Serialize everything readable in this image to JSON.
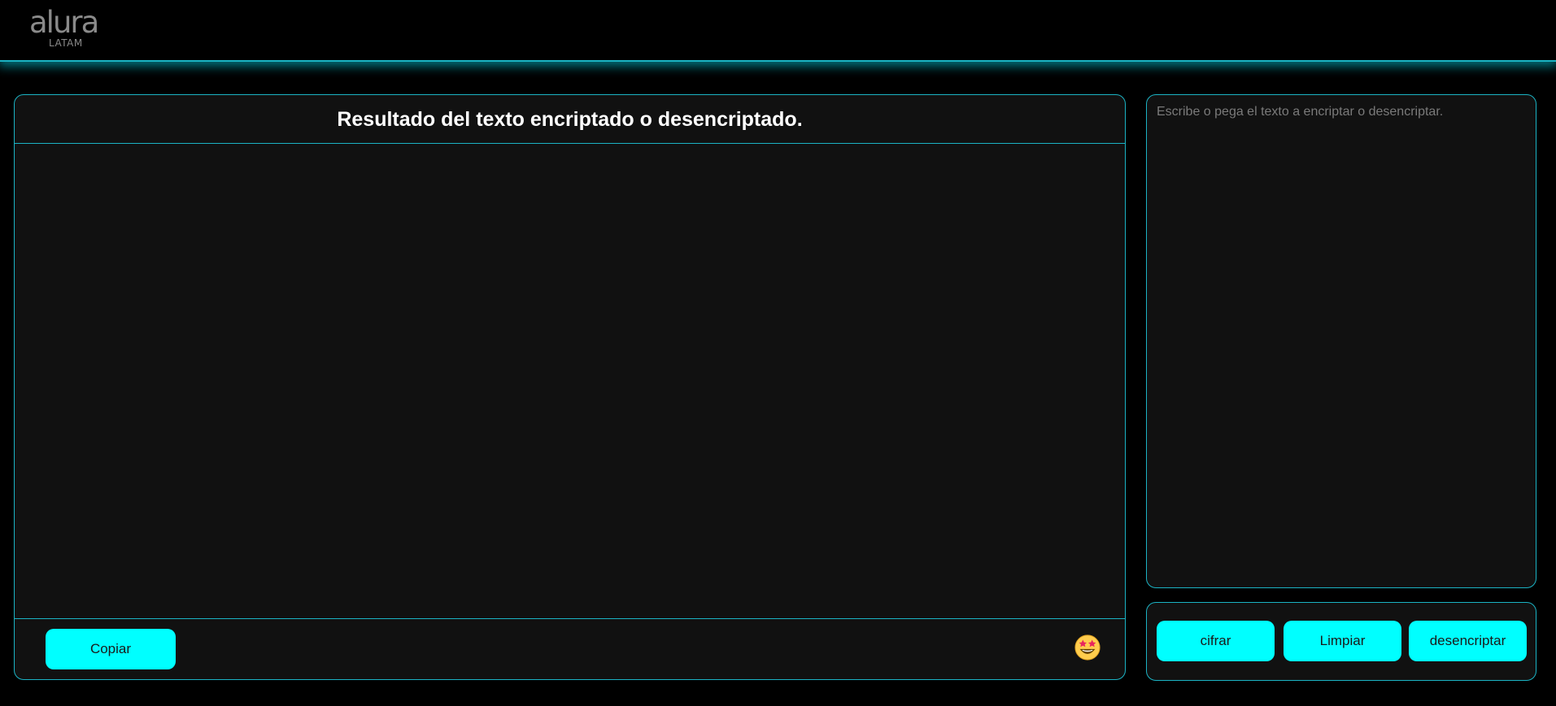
{
  "header": {
    "logo_main": "alura",
    "logo_sub": "LATAM"
  },
  "result": {
    "title": "Resultado del texto encriptado o desencriptado.",
    "content": "",
    "copy_label": "Copiar",
    "emoji_icon": "star-struck-emoji-icon"
  },
  "input": {
    "placeholder": "Escribe o pega el texto a encriptar o desencriptar.",
    "value": ""
  },
  "actions": {
    "encrypt_label": "cifrar",
    "clear_label": "Limpiar",
    "decrypt_label": "desencriptar"
  },
  "colors": {
    "accent": "#00ffff",
    "border": "#1bb3c4",
    "panel": "#111111",
    "background": "#000000"
  }
}
